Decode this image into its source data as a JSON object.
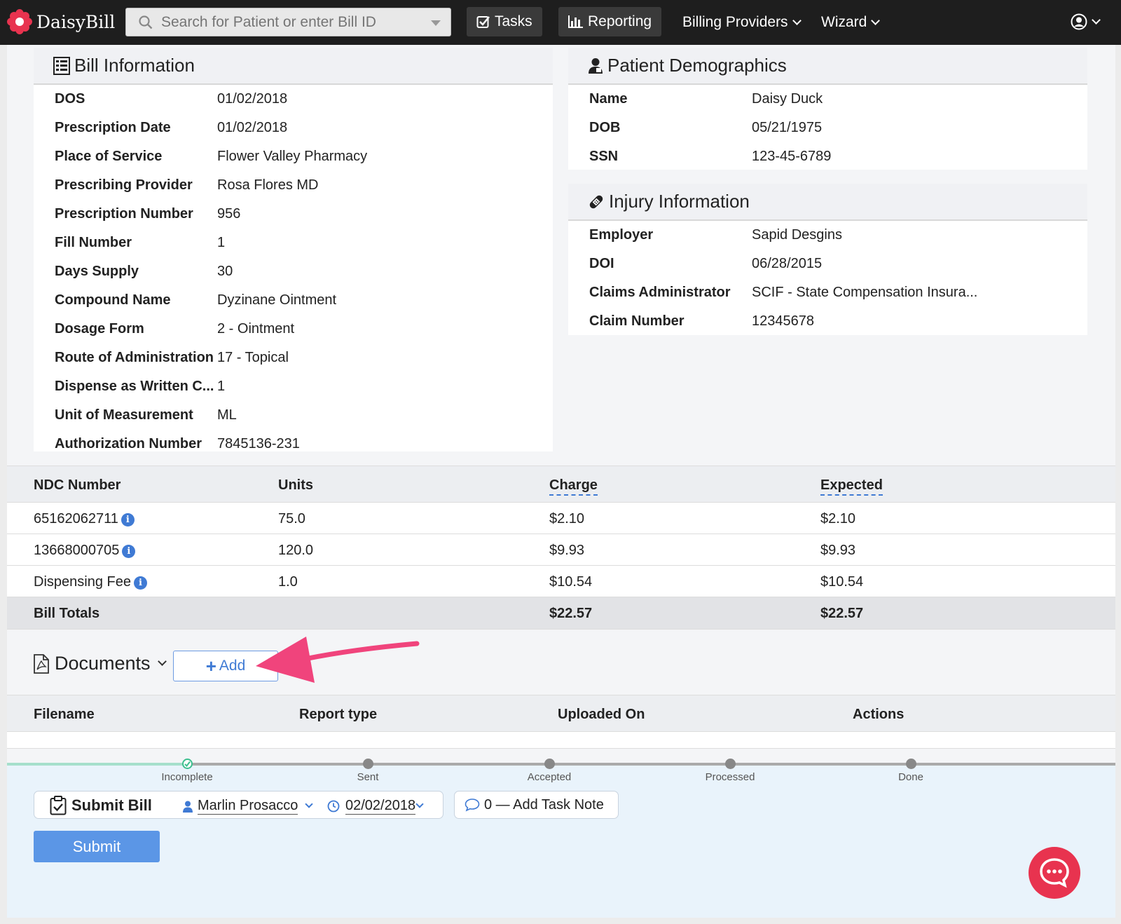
{
  "nav": {
    "brand": "DaisyBill",
    "search_placeholder": "Search for Patient or enter Bill ID",
    "tasks": "Tasks",
    "reporting": "Reporting",
    "billing_providers": "Billing Providers",
    "wizard": "Wizard"
  },
  "bill_info": {
    "title": "Bill Information",
    "rows": [
      {
        "label": "DOS",
        "value": "01/02/2018"
      },
      {
        "label": "Prescription Date",
        "value": "01/02/2018"
      },
      {
        "label": "Place of Service",
        "value": "Flower Valley Pharmacy"
      },
      {
        "label": "Prescribing Provider",
        "value": "Rosa Flores MD"
      },
      {
        "label": "Prescription Number",
        "value": "956"
      },
      {
        "label": "Fill Number",
        "value": "1"
      },
      {
        "label": "Days Supply",
        "value": "30"
      },
      {
        "label": "Compound Name",
        "value": "Dyzinane Ointment"
      },
      {
        "label": "Dosage Form",
        "value": "2 - Ointment"
      },
      {
        "label": "Route of Administration",
        "value": "17 - Topical"
      },
      {
        "label": "Dispense as Written C...",
        "value": "1"
      },
      {
        "label": "Unit of Measurement",
        "value": "ML"
      },
      {
        "label": "Authorization Number",
        "value": "7845136-231"
      }
    ]
  },
  "patient": {
    "title": "Patient Demographics",
    "rows": [
      {
        "label": "Name",
        "value": "Daisy Duck"
      },
      {
        "label": "DOB",
        "value": "05/21/1975"
      },
      {
        "label": "SSN",
        "value": "123-45-6789"
      }
    ]
  },
  "injury": {
    "title": "Injury Information",
    "rows": [
      {
        "label": "Employer",
        "value": "Sapid Desgins"
      },
      {
        "label": "DOI",
        "value": "06/28/2015"
      },
      {
        "label": "Claims Administrator",
        "value": "SCIF - State Compensation Insura..."
      },
      {
        "label": "Claim Number",
        "value": "12345678"
      }
    ]
  },
  "lines": {
    "headers": {
      "ndc": "NDC Number",
      "units": "Units",
      "charge": "Charge",
      "expected": "Expected"
    },
    "rows": [
      {
        "ndc": "65162062711",
        "units": "75.0",
        "charge": "$2.10",
        "expected": "$2.10"
      },
      {
        "ndc": "13668000705",
        "units": "120.0",
        "charge": "$9.93",
        "expected": "$9.93"
      },
      {
        "ndc": "Dispensing Fee",
        "units": "1.0",
        "charge": "$10.54",
        "expected": "$10.54"
      }
    ],
    "totals": {
      "label": "Bill Totals",
      "charge": "$22.57",
      "expected": "$22.57"
    }
  },
  "documents": {
    "title": "Documents",
    "add_label": "Add",
    "headers": {
      "filename": "Filename",
      "report_type": "Report type",
      "uploaded_on": "Uploaded On",
      "actions": "Actions"
    }
  },
  "progress": {
    "steps": [
      "Incomplete",
      "Sent",
      "Accepted",
      "Processed",
      "Done"
    ],
    "done_color": "#7fd6b8",
    "current_step": 0
  },
  "task": {
    "title": "Submit Bill",
    "assignee": "Marlin Prosacco",
    "due_date": "02/02/2018",
    "note": "0 — Add Task Note",
    "submit_label": "Submit"
  },
  "colors": {
    "accent": "#3f7ad4",
    "submit": "#5b96e6",
    "chat": "#e8334f",
    "annotation_arrow": "#f0447c"
  }
}
